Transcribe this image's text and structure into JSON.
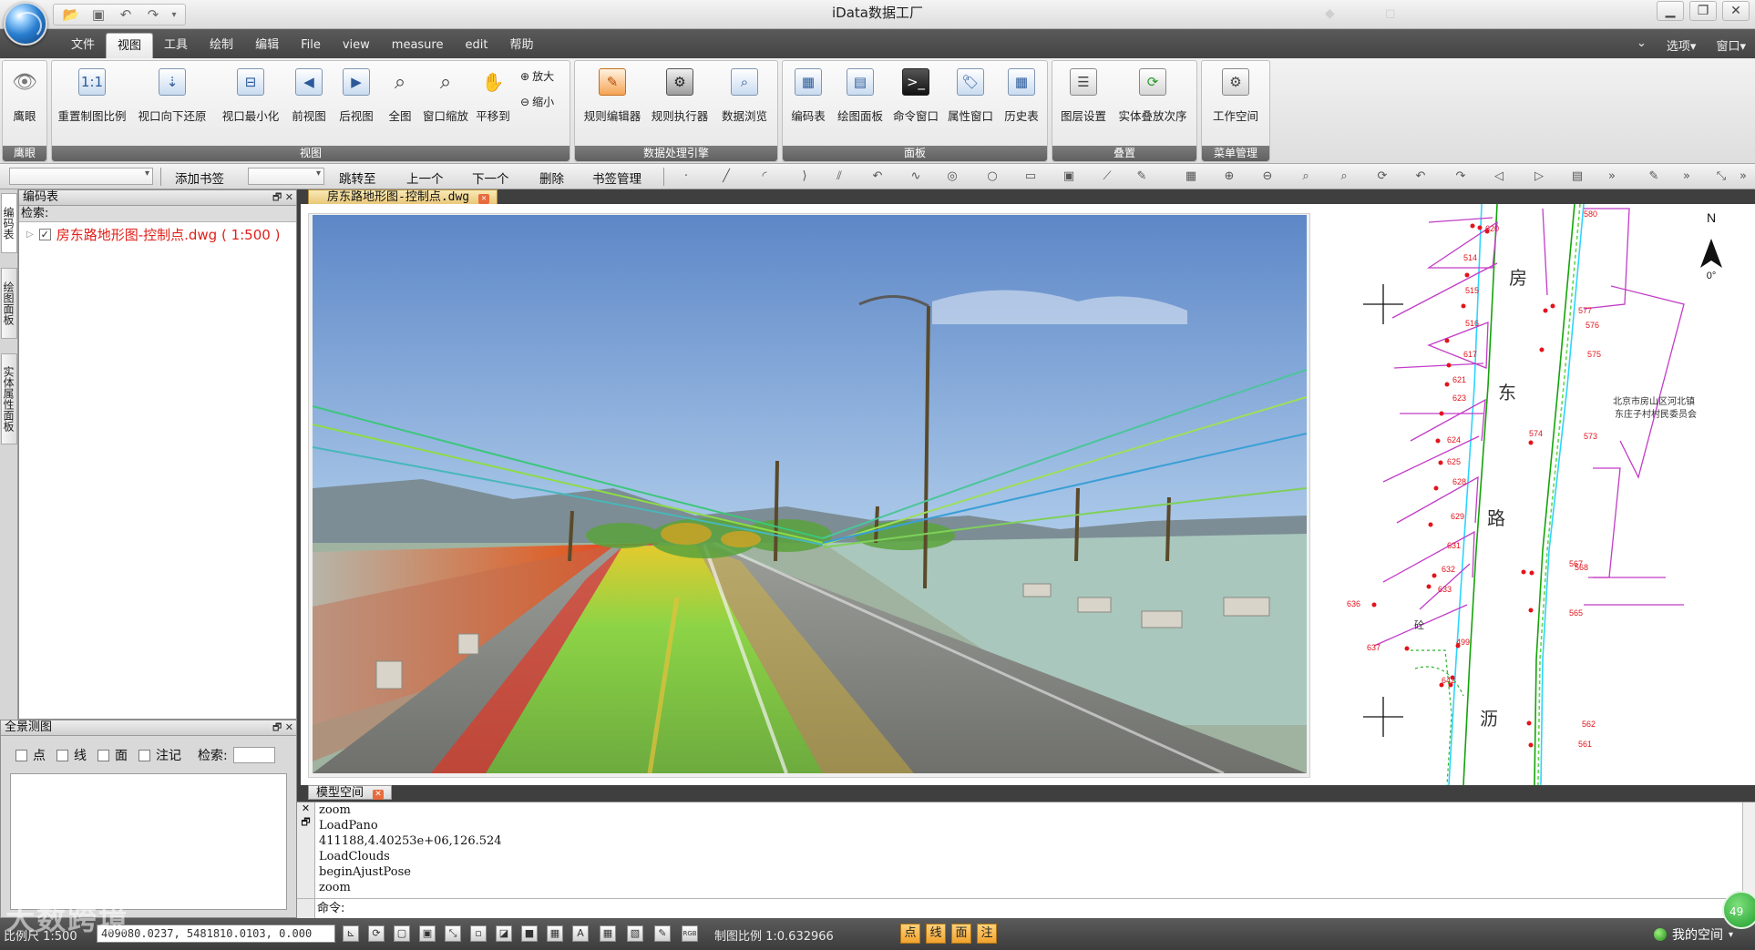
{
  "app": {
    "title": "iData数据工厂"
  },
  "menu": {
    "tabs": [
      "文件",
      "视图",
      "工具",
      "绘制",
      "编辑",
      "File",
      "view",
      "measure",
      "edit",
      "帮助"
    ],
    "active_index": 1,
    "options": "选项",
    "window": "窗口"
  },
  "ribbon": {
    "eye": {
      "btn": "鹰眼",
      "group": "鹰眼"
    },
    "view": {
      "group": "视图",
      "buttons": [
        "重置制图比例",
        "视口向下还原",
        "视口最小化",
        "前视图",
        "后视图",
        "全图",
        "窗口缩放",
        "平移到"
      ],
      "zoom_in": "放大",
      "zoom_out": "缩小"
    },
    "rules": {
      "group": "数据处理引擎",
      "buttons": [
        "规则编辑器",
        "规则执行器",
        "数据浏览"
      ]
    },
    "panels": {
      "group": "面板",
      "buttons": [
        "编码表",
        "绘图面板",
        "命令窗口",
        "属性窗口",
        "历史表"
      ]
    },
    "overlay": {
      "group": "叠置",
      "buttons": [
        "图层设置",
        "实体叠放次序"
      ]
    },
    "menu_mgmt": {
      "group": "菜单管理",
      "buttons": [
        "工作空间"
      ]
    }
  },
  "toolbar2": {
    "add_bookmark": "添加书签",
    "goto": "跳转至",
    "prev": "上一个",
    "next": "下一个",
    "delete": "删除",
    "bookmark_mgmt": "书签管理"
  },
  "side_tabs": [
    "编码表",
    "绘图面板",
    "实体属性面板"
  ],
  "code_panel": {
    "title": "编码表",
    "search_label": "检索:",
    "tree_item": "房东路地形图-控制点.dwg ( 1:500 )"
  },
  "doc": {
    "tab": "房东路地形图-控制点.dwg",
    "model_tab": "模型空间"
  },
  "cad": {
    "north": "N",
    "north_angle": "0°",
    "road_chars": [
      "房",
      "东",
      "路",
      "沥"
    ],
    "place_line1": "北京市房山区河北镇",
    "place_line2": "东庄子村村民委员会",
    "labels": [
      "580",
      "577",
      "576",
      "575",
      "574",
      "573",
      "567",
      "568",
      "565",
      "562",
      "561",
      "514",
      "515",
      "516",
      "617",
      "621",
      "623",
      "624",
      "625",
      "628",
      "629",
      "631",
      "632",
      "633",
      "636",
      "637",
      "499",
      "642",
      "620",
      "砼"
    ]
  },
  "command": {
    "lines": [
      "zoom",
      "LoadPano",
      "411188,4.40253e+06,126.524",
      "LoadClouds",
      "beginAjustPose",
      "zoom"
    ],
    "prompt": "命令:"
  },
  "pano_panel": {
    "title": "全景测图",
    "filters": [
      "点",
      "线",
      "面",
      "注记"
    ],
    "search_label": "检索:"
  },
  "status": {
    "scale": "比例尺 1:500",
    "coords": "409080.0237, 5481810.0103, 0.000",
    "map_scale": "制图比例 1:0.632966",
    "snap": [
      "点",
      "线",
      "面",
      "注"
    ],
    "workspace": "我的空间",
    "badge": "49",
    "watermark": "大数跨境"
  }
}
